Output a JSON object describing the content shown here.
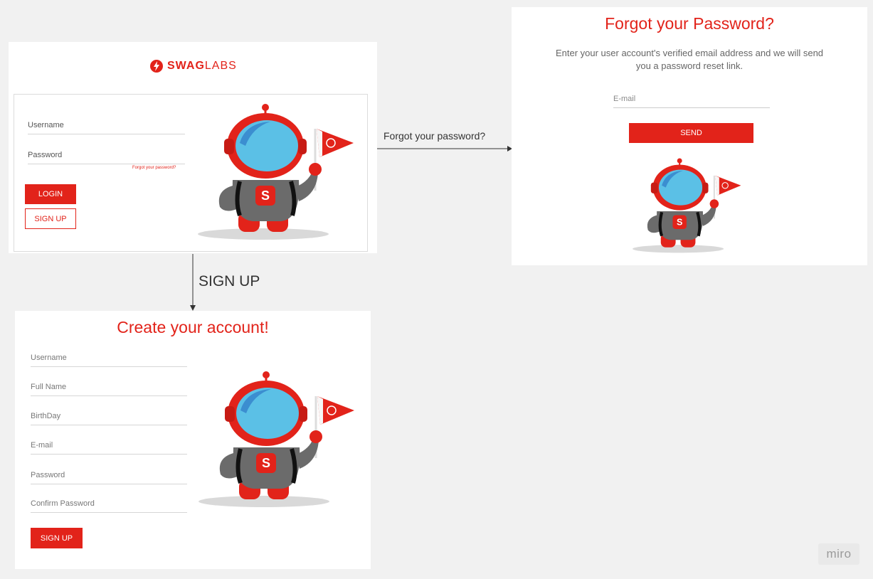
{
  "login": {
    "brand_bold": "SWAG",
    "brand_light": "LABS",
    "username_placeholder": "Username",
    "password_placeholder": "Password",
    "forgot_link": "Forgot your password?",
    "login_button": "LOGIN",
    "signup_button": "SIGN UP"
  },
  "connectors": {
    "forgot_label": "Forgot your password?",
    "signup_label": "SIGN UP"
  },
  "forgot": {
    "title": "Forgot your Password?",
    "description": "Enter your user account's verified email address and we will send you a password reset link.",
    "email_placeholder": "E-mail",
    "send_button": "SEND"
  },
  "signup": {
    "title": "Create your account!",
    "fields": [
      "Username",
      "Full Name",
      "BirthDay",
      "E-mail",
      "Password",
      "Confirm Password"
    ],
    "signup_button": "SIGN UP"
  },
  "watermark": "miro",
  "colors": {
    "accent": "#e2231a",
    "helmet_visor": "#5bc0e6",
    "hoodie": "#6b6b6b",
    "background": "#f1f1f1"
  },
  "icons": [
    "swaglabs-logo-icon",
    "robot-mascot-illustration",
    "arrow-right-icon",
    "arrow-down-icon"
  ]
}
